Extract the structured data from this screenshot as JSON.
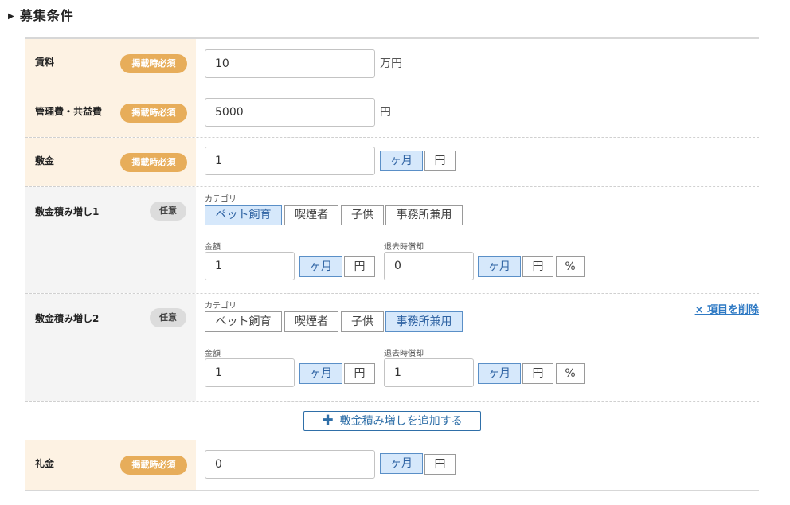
{
  "section": {
    "title": "募集条件"
  },
  "badges": {
    "required": "掲載時必須",
    "optional": "任意"
  },
  "rent": {
    "label": "賃料",
    "value": "10",
    "unit": "万円"
  },
  "management_fee": {
    "label": "管理費・共益費",
    "value": "5000",
    "unit": "円"
  },
  "deposit": {
    "label": "敷金",
    "value": "1",
    "unit_options": [
      "ヶ月",
      "円"
    ],
    "selected_unit": "ヶ月"
  },
  "common": {
    "category_label": "カテゴリ",
    "categories": [
      "ペット飼育",
      "喫煙者",
      "子供",
      "事務所兼用"
    ],
    "amount_label": "金額",
    "refund_label": "退去時償却",
    "amount_units": [
      "ヶ月",
      "円"
    ],
    "refund_units": [
      "ヶ月",
      "円",
      "%"
    ]
  },
  "extra_deposits": [
    {
      "label": "敷金積み増し1",
      "selected_category": "ペット飼育",
      "amount": "1",
      "amount_unit": "ヶ月",
      "refund": "0",
      "refund_unit": "ヶ月"
    },
    {
      "label": "敷金積み増し2",
      "selected_category": "事務所兼用",
      "amount": "1",
      "amount_unit": "ヶ月",
      "refund": "1",
      "refund_unit": "ヶ月",
      "delete_label": "× 項目を削除"
    }
  ],
  "add_extra_button": "敷金積み増しを追加する",
  "key_money": {
    "label": "礼金",
    "value": "0",
    "unit_options": [
      "ヶ月",
      "円"
    ],
    "selected_unit": "ヶ月"
  },
  "colors": {
    "required_badge": "#e7ad5a",
    "required_bg": "#fdf2e3",
    "optional_bg": "#f4f4f4",
    "toggle_selected": "#d6e8fb",
    "link": "#2f7ac4"
  },
  "icons": {
    "section": "triangle-right-icon",
    "add": "plus-icon",
    "delete": "close-icon"
  }
}
